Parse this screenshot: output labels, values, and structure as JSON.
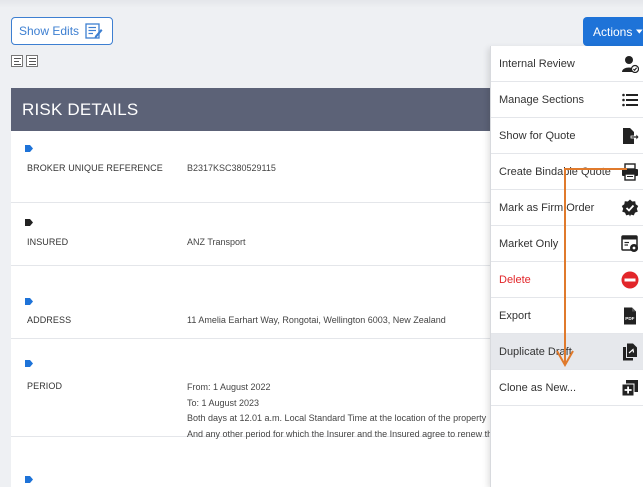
{
  "toolbar": {
    "show_edits_label": "Show Edits",
    "actions_label": "Actions"
  },
  "risk_details": {
    "title": "RISK DETAILS",
    "rows": [
      {
        "label": "BROKER UNIQUE REFERENCE",
        "value": "B2317KSC380529115"
      },
      {
        "label": "INSURED",
        "value": "ANZ Transport"
      },
      {
        "label": "ADDRESS",
        "value": "11 Amelia Earhart Way, Rongotai, Wellington 6003, New Zealand"
      },
      {
        "label": "PERIOD",
        "lines": [
          "From: 1 August 2022",
          "To: 1 August 2023",
          "Both days at 12.01 a.m. Local Standard Time at the location of the property",
          "And any other period for which the Insurer and the Insured agree to renew the Policy."
        ]
      }
    ]
  },
  "actions_menu": {
    "items": [
      {
        "label": "Internal Review",
        "icon": "person-check-icon"
      },
      {
        "label": "Manage Sections",
        "icon": "list-icon"
      },
      {
        "label": "Show for Quote",
        "icon": "file-export-icon"
      },
      {
        "label": "Create Bindable Quote",
        "icon": "printer-icon"
      },
      {
        "label": "Mark as Firm Order",
        "icon": "badge-check-icon"
      },
      {
        "label": "Market Only",
        "icon": "window-eye-icon"
      },
      {
        "label": "Delete",
        "icon": "minus-circle-icon",
        "color": "#e2262a"
      },
      {
        "label": "Export",
        "icon": "pdf-icon"
      },
      {
        "label": "Duplicate Draft",
        "icon": "duplicate-file-icon"
      },
      {
        "label": "Clone as New...",
        "icon": "clone-plus-icon"
      }
    ],
    "highlighted": "Duplicate Draft"
  },
  "colors": {
    "primary": "#1e73d8",
    "header_bg": "#5c6277",
    "tag": "#1e73d8",
    "annotation_arrow": "#e07a2c",
    "delete": "#e2262a"
  }
}
